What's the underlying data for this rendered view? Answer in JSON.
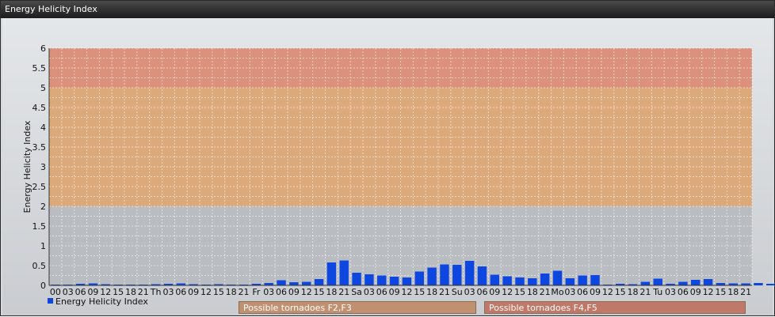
{
  "window": {
    "title": "Energy Helicity Index"
  },
  "colors": {
    "bar": "#0e46e0",
    "band_high": "#e08a6e",
    "band_mid": "#e2a66e",
    "zone_f2f3": "#c09070",
    "zone_f4f5": "#c07868"
  },
  "legend": {
    "label": "Energy Helicity Index"
  },
  "zones": [
    {
      "label": "Possible tornadoes F2,F3"
    },
    {
      "label": "Possible tornadoes F4,F5"
    }
  ],
  "chart_data": {
    "type": "bar",
    "ylabel": "Energy Helicity Index",
    "ylim": [
      0,
      6
    ],
    "yticks": [
      "0",
      "0.5",
      "1",
      "1.5",
      "2",
      "2.5",
      "3",
      "3.5",
      "4",
      "4.5",
      "5",
      "5.5",
      "6"
    ],
    "bands": [
      {
        "from": 2,
        "to": 5
      },
      {
        "from": 5,
        "to": 6
      }
    ],
    "grid": true,
    "legend_position": "bottom-left",
    "categories": [
      "00",
      "03",
      "06",
      "09",
      "12",
      "15",
      "18",
      "21",
      "Th",
      "03",
      "06",
      "09",
      "12",
      "15",
      "18",
      "21",
      "Fr",
      "03",
      "06",
      "09",
      "12",
      "15",
      "18",
      "21",
      "Sa",
      "03",
      "06",
      "09",
      "12",
      "15",
      "18",
      "21",
      "Su",
      "03",
      "06",
      "09",
      "12",
      "15",
      "18",
      "21",
      "Mo",
      "03",
      "06",
      "09",
      "12",
      "15",
      "18",
      "21",
      "Tu",
      "03",
      "06",
      "09",
      "12",
      "15",
      "18",
      "21"
    ],
    "values": [
      0.02,
      0.02,
      0.04,
      0.05,
      0.03,
      0.02,
      0.02,
      0.02,
      0.03,
      0.04,
      0.05,
      0.03,
      0.02,
      0.03,
      0.02,
      0.02,
      0.04,
      0.06,
      0.13,
      0.08,
      0.09,
      0.16,
      0.58,
      0.63,
      0.32,
      0.28,
      0.25,
      0.22,
      0.2,
      0.35,
      0.45,
      0.53,
      0.52,
      0.62,
      0.48,
      0.27,
      0.23,
      0.2,
      0.18,
      0.3,
      0.37,
      0.18,
      0.25,
      0.26,
      0.02,
      0.04,
      0.03,
      0.09,
      0.17,
      0.04,
      0.09,
      0.14,
      0.16,
      0.06,
      0.05,
      0.05,
      0.06,
      0.04
    ]
  }
}
